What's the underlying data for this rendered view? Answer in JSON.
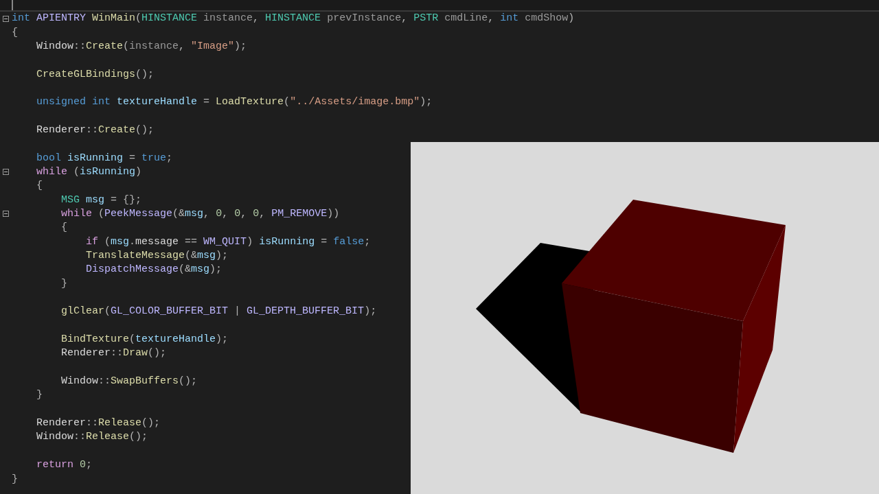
{
  "editor": {
    "lines": [
      {
        "kind": "code",
        "expanded": true,
        "tokens": [
          {
            "kind": "kw",
            "text": "int "
          },
          {
            "kind": "macro",
            "text": "APIENTRY "
          },
          {
            "kind": "fn",
            "text": "WinMain"
          },
          {
            "kind": "p",
            "text": "("
          },
          {
            "kind": "type",
            "text": "HINSTANCE "
          },
          {
            "kind": "param",
            "text": "instance"
          },
          {
            "kind": "p",
            "text": ", "
          },
          {
            "kind": "type",
            "text": "HINSTANCE "
          },
          {
            "kind": "param",
            "text": "prevInstance"
          },
          {
            "kind": "p",
            "text": ", "
          },
          {
            "kind": "type",
            "text": "PSTR "
          },
          {
            "kind": "param",
            "text": "cmdLine"
          },
          {
            "kind": "p",
            "text": ", "
          },
          {
            "kind": "kw",
            "text": "int "
          },
          {
            "kind": "param",
            "text": "cmdShow"
          },
          {
            "kind": "p",
            "text": ")"
          }
        ]
      },
      {
        "kind": "code",
        "tokens": [
          {
            "kind": "p",
            "text": "{"
          }
        ]
      },
      {
        "kind": "code",
        "tokens": [
          {
            "kind": "plain",
            "text": "    Window"
          },
          {
            "kind": "p",
            "text": "::"
          },
          {
            "kind": "fn",
            "text": "Create"
          },
          {
            "kind": "p",
            "text": "("
          },
          {
            "kind": "param",
            "text": "instance"
          },
          {
            "kind": "p",
            "text": ", "
          },
          {
            "kind": "str",
            "text": "\"Image\""
          },
          {
            "kind": "p",
            "text": ");"
          }
        ]
      },
      {
        "kind": "blank"
      },
      {
        "kind": "code",
        "tokens": [
          {
            "kind": "fn",
            "text": "    CreateGLBindings"
          },
          {
            "kind": "p",
            "text": "();"
          }
        ]
      },
      {
        "kind": "blank"
      },
      {
        "kind": "code",
        "tokens": [
          {
            "kind": "kw",
            "text": "    unsigned int "
          },
          {
            "kind": "var",
            "text": "textureHandle"
          },
          {
            "kind": "p",
            "text": " = "
          },
          {
            "kind": "fn",
            "text": "LoadTexture"
          },
          {
            "kind": "p",
            "text": "("
          },
          {
            "kind": "str",
            "text": "\"../Assets/image.bmp\""
          },
          {
            "kind": "p",
            "text": ");"
          }
        ]
      },
      {
        "kind": "blank"
      },
      {
        "kind": "code",
        "tokens": [
          {
            "kind": "plain",
            "text": "    Renderer"
          },
          {
            "kind": "p",
            "text": "::"
          },
          {
            "kind": "fn",
            "text": "Create"
          },
          {
            "kind": "p",
            "text": "();"
          }
        ]
      },
      {
        "kind": "blank"
      },
      {
        "kind": "code",
        "tokens": [
          {
            "kind": "kw",
            "text": "    bool "
          },
          {
            "kind": "var",
            "text": "isRunning"
          },
          {
            "kind": "p",
            "text": " = "
          },
          {
            "kind": "kw",
            "text": "true"
          },
          {
            "kind": "p",
            "text": ";"
          }
        ]
      },
      {
        "kind": "code",
        "expanded": true,
        "tokens": [
          {
            "kind": "ctrl",
            "text": "    while "
          },
          {
            "kind": "p",
            "text": "("
          },
          {
            "kind": "var",
            "text": "isRunning"
          },
          {
            "kind": "p",
            "text": ")"
          }
        ]
      },
      {
        "kind": "code",
        "tokens": [
          {
            "kind": "p",
            "text": "    {"
          }
        ]
      },
      {
        "kind": "code",
        "tokens": [
          {
            "kind": "type",
            "text": "        MSG "
          },
          {
            "kind": "var",
            "text": "msg"
          },
          {
            "kind": "p",
            "text": " = {};"
          }
        ]
      },
      {
        "kind": "code",
        "expanded": true,
        "tokens": [
          {
            "kind": "ctrl",
            "text": "        while "
          },
          {
            "kind": "p",
            "text": "("
          },
          {
            "kind": "macro",
            "text": "PeekMessage"
          },
          {
            "kind": "p",
            "text": "(&"
          },
          {
            "kind": "var",
            "text": "msg"
          },
          {
            "kind": "p",
            "text": ", "
          },
          {
            "kind": "num",
            "text": "0"
          },
          {
            "kind": "p",
            "text": ", "
          },
          {
            "kind": "num",
            "text": "0"
          },
          {
            "kind": "p",
            "text": ", "
          },
          {
            "kind": "num",
            "text": "0"
          },
          {
            "kind": "p",
            "text": ", "
          },
          {
            "kind": "macro",
            "text": "PM_REMOVE"
          },
          {
            "kind": "p",
            "text": "))"
          }
        ]
      },
      {
        "kind": "code",
        "tokens": [
          {
            "kind": "p",
            "text": "        {"
          }
        ]
      },
      {
        "kind": "code",
        "tokens": [
          {
            "kind": "ctrl",
            "text": "            if "
          },
          {
            "kind": "p",
            "text": "("
          },
          {
            "kind": "var",
            "text": "msg"
          },
          {
            "kind": "p",
            "text": "."
          },
          {
            "kind": "plain",
            "text": "message"
          },
          {
            "kind": "p",
            "text": " == "
          },
          {
            "kind": "macro",
            "text": "WM_QUIT"
          },
          {
            "kind": "p",
            "text": ") "
          },
          {
            "kind": "var",
            "text": "isRunning"
          },
          {
            "kind": "p",
            "text": " = "
          },
          {
            "kind": "kw",
            "text": "false"
          },
          {
            "kind": "p",
            "text": ";"
          }
        ]
      },
      {
        "kind": "code",
        "tokens": [
          {
            "kind": "fn",
            "text": "            TranslateMessage"
          },
          {
            "kind": "p",
            "text": "(&"
          },
          {
            "kind": "var",
            "text": "msg"
          },
          {
            "kind": "p",
            "text": ");"
          }
        ]
      },
      {
        "kind": "code",
        "tokens": [
          {
            "kind": "macro",
            "text": "            DispatchMessage"
          },
          {
            "kind": "p",
            "text": "(&"
          },
          {
            "kind": "var",
            "text": "msg"
          },
          {
            "kind": "p",
            "text": ");"
          }
        ]
      },
      {
        "kind": "code",
        "tokens": [
          {
            "kind": "p",
            "text": "        }"
          }
        ]
      },
      {
        "kind": "blank"
      },
      {
        "kind": "code",
        "tokens": [
          {
            "kind": "fn",
            "text": "        glClear"
          },
          {
            "kind": "p",
            "text": "("
          },
          {
            "kind": "macro",
            "text": "GL_COLOR_BUFFER_BIT"
          },
          {
            "kind": "p",
            "text": " | "
          },
          {
            "kind": "macro",
            "text": "GL_DEPTH_BUFFER_BIT"
          },
          {
            "kind": "p",
            "text": ");"
          }
        ]
      },
      {
        "kind": "blank"
      },
      {
        "kind": "code",
        "tokens": [
          {
            "kind": "fn",
            "text": "        BindTexture"
          },
          {
            "kind": "p",
            "text": "("
          },
          {
            "kind": "var",
            "text": "textureHandle"
          },
          {
            "kind": "p",
            "text": ");"
          }
        ]
      },
      {
        "kind": "code",
        "tokens": [
          {
            "kind": "plain",
            "text": "        Renderer"
          },
          {
            "kind": "p",
            "text": "::"
          },
          {
            "kind": "fn",
            "text": "Draw"
          },
          {
            "kind": "p",
            "text": "();"
          }
        ]
      },
      {
        "kind": "blank"
      },
      {
        "kind": "code",
        "tokens": [
          {
            "kind": "plain",
            "text": "        Window"
          },
          {
            "kind": "p",
            "text": "::"
          },
          {
            "kind": "fn",
            "text": "SwapBuffers"
          },
          {
            "kind": "p",
            "text": "();"
          }
        ]
      },
      {
        "kind": "code",
        "tokens": [
          {
            "kind": "p",
            "text": "    }"
          }
        ]
      },
      {
        "kind": "blank"
      },
      {
        "kind": "code",
        "tokens": [
          {
            "kind": "plain",
            "text": "    Renderer"
          },
          {
            "kind": "p",
            "text": "::"
          },
          {
            "kind": "fn",
            "text": "Release"
          },
          {
            "kind": "p",
            "text": "();"
          }
        ]
      },
      {
        "kind": "code",
        "tokens": [
          {
            "kind": "plain",
            "text": "    Window"
          },
          {
            "kind": "p",
            "text": "::"
          },
          {
            "kind": "fn",
            "text": "Release"
          },
          {
            "kind": "p",
            "text": "();"
          }
        ]
      },
      {
        "kind": "blank"
      },
      {
        "kind": "code",
        "tokens": [
          {
            "kind": "ctrl",
            "text": "    return "
          },
          {
            "kind": "num",
            "text": "0"
          },
          {
            "kind": "p",
            "text": ";"
          }
        ]
      },
      {
        "kind": "code",
        "tokens": [
          {
            "kind": "p",
            "text": "}"
          }
        ]
      }
    ]
  }
}
